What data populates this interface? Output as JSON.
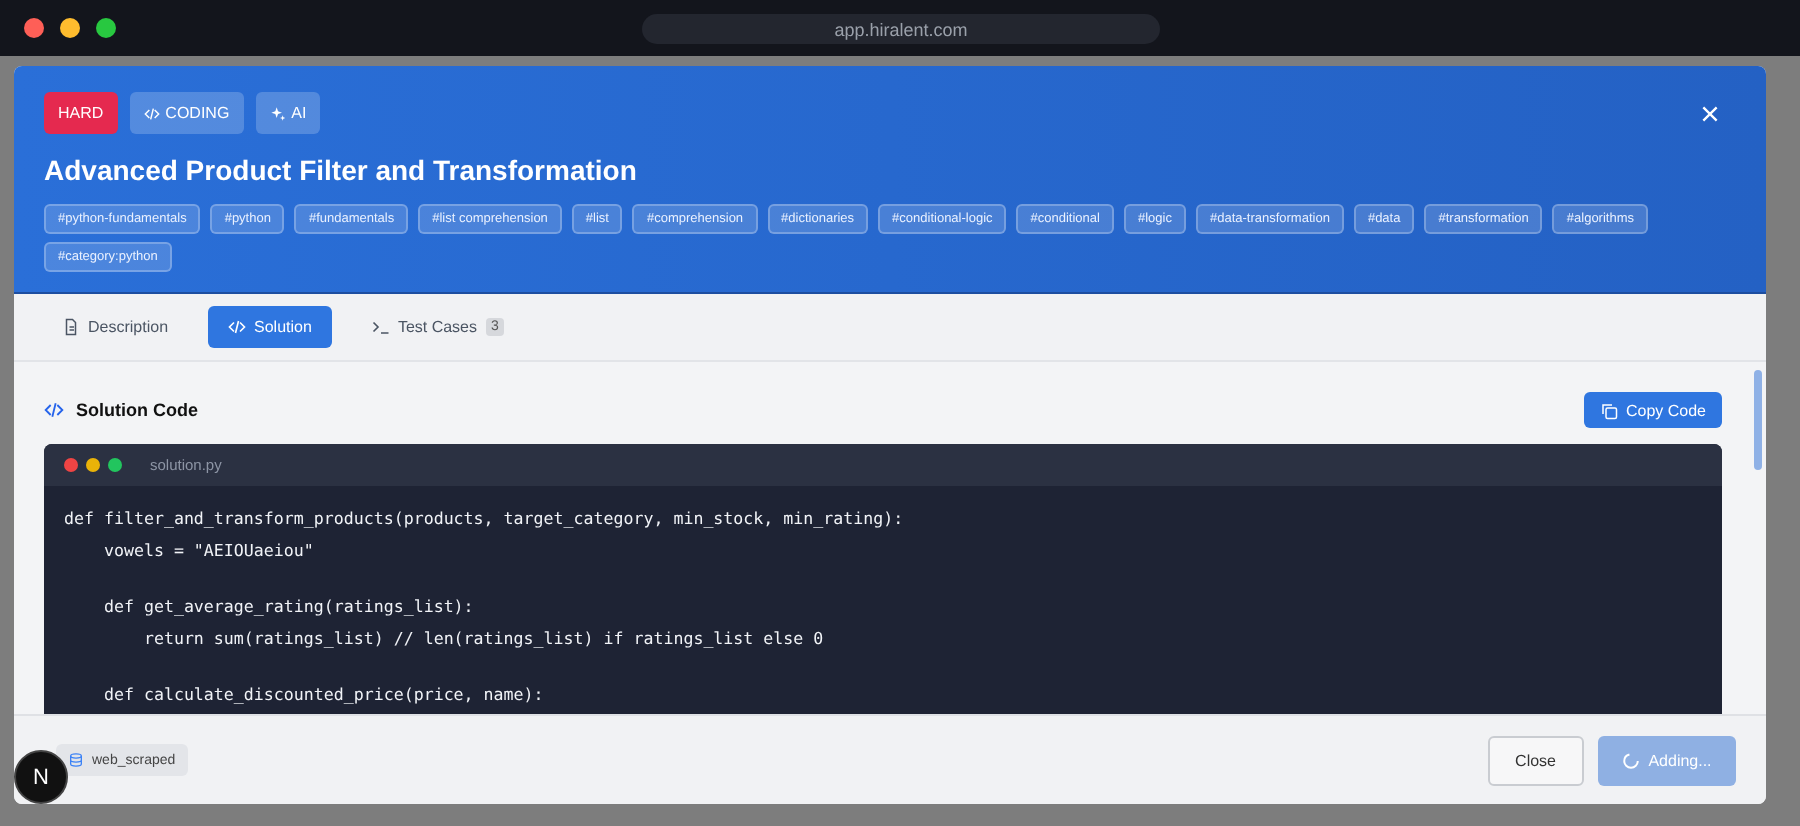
{
  "browser": {
    "url": "app.hiralent.com"
  },
  "header": {
    "badges": [
      {
        "kind": "difficulty",
        "label": "HARD"
      },
      {
        "kind": "code",
        "label": "CODING"
      },
      {
        "kind": "ai",
        "label": "AI"
      }
    ],
    "title": "Advanced Product Filter and Transformation",
    "tags": [
      "#python-fundamentals",
      "#python",
      "#fundamentals",
      "#list comprehension",
      "#list",
      "#comprehension",
      "#dictionaries",
      "#conditional-logic",
      "#conditional",
      "#logic",
      "#data-transformation",
      "#data",
      "#transformation",
      "#algorithms",
      "#category:python"
    ]
  },
  "tabs": [
    {
      "kind": "doc",
      "label": "Description",
      "selected": false
    },
    {
      "kind": "code",
      "label": "Solution",
      "selected": true
    },
    {
      "kind": "terminal",
      "label": "Test Cases",
      "count": "3",
      "selected": false
    }
  ],
  "solution": {
    "heading": "Solution Code",
    "copy_button": "Copy Code",
    "file_name": "solution.py",
    "code_groups": [
      [
        "def filter_and_transform_products(products, target_category, min_stock, min_rating):",
        "    vowels = \"AEIOUaeiou\""
      ],
      [
        "    def get_average_rating(ratings_list):",
        "        return sum(ratings_list) // len(ratings_list) if ratings_list else 0"
      ],
      [
        "    def calculate_discounted_price(price, name):"
      ]
    ]
  },
  "footer": {
    "source": "web_scraped",
    "close_button": "Close",
    "submit_button": "Adding...",
    "submit_loading": true
  },
  "dev_badge": "N"
}
